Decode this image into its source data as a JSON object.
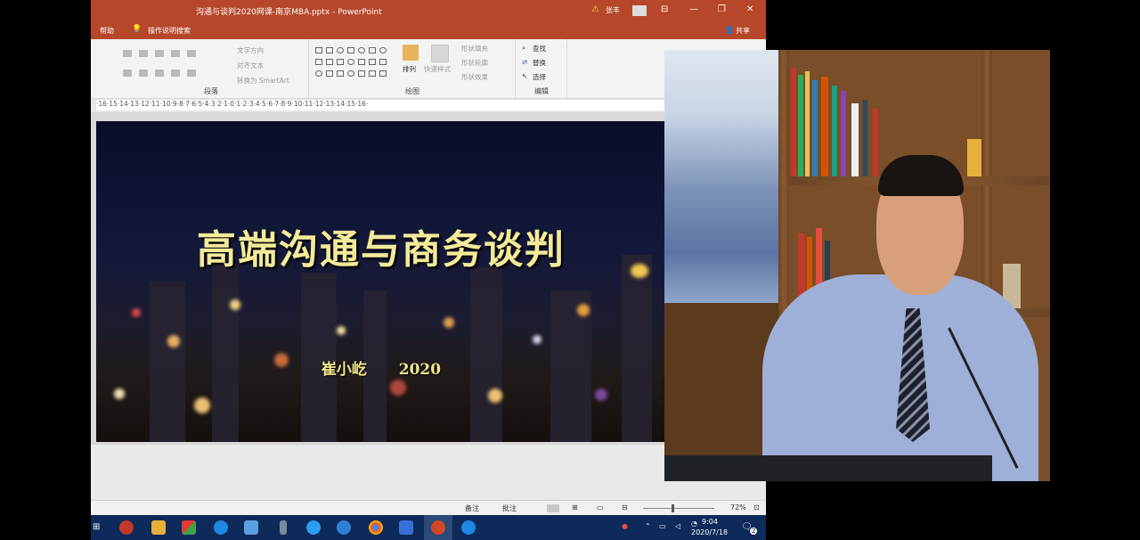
{
  "window": {
    "title": "沟通与谈判2020网课-南京MBA.pptx  -  PowerPoint",
    "user": "张丰"
  },
  "menu": {
    "help": "帮助",
    "tell_me": "操作说明搜索",
    "share": "共享"
  },
  "ribbon": {
    "paragraph": {
      "label": "段落",
      "text_direction": "文字方向",
      "align_text": "对齐文本",
      "smartart": "转换为 SmartArt"
    },
    "drawing": {
      "label": "绘图",
      "arrange": "排列",
      "quick_styles": "快速样式",
      "fill": "形状填充",
      "outline": "形状轮廓",
      "effects": "形状效果"
    },
    "editing": {
      "label": "编辑",
      "find": "查找",
      "replace": "替换",
      "select": "选择"
    }
  },
  "ruler": {
    "text": "·16·15·14·13·12·11·10·9·8·7·6·5·4·3·2·1·0·1·2·3·4·5·6·7·8·9·10·11·12·13·14·15·16·"
  },
  "slide": {
    "title": "高端沟通与商务谈判",
    "author": "崔小屹",
    "year": "2020"
  },
  "status": {
    "notes": "备注",
    "comments": "批注",
    "zoom": "72%"
  },
  "taskbar": {
    "time": "9:04",
    "date": "2020/7/18",
    "notifications": "2"
  },
  "colors": {
    "titlebar": "#b7472a",
    "slide_title": "#f3ea9a",
    "taskbar": "#0e2a5a"
  },
  "icons": [
    "lightbulb-icon",
    "person-icon",
    "minimize-icon",
    "restore-icon",
    "close-icon",
    "find-icon",
    "replace-icon",
    "select-icon",
    "windows-start-icon",
    "edge-icon",
    "chrome-icon",
    "powerpoint-icon"
  ]
}
